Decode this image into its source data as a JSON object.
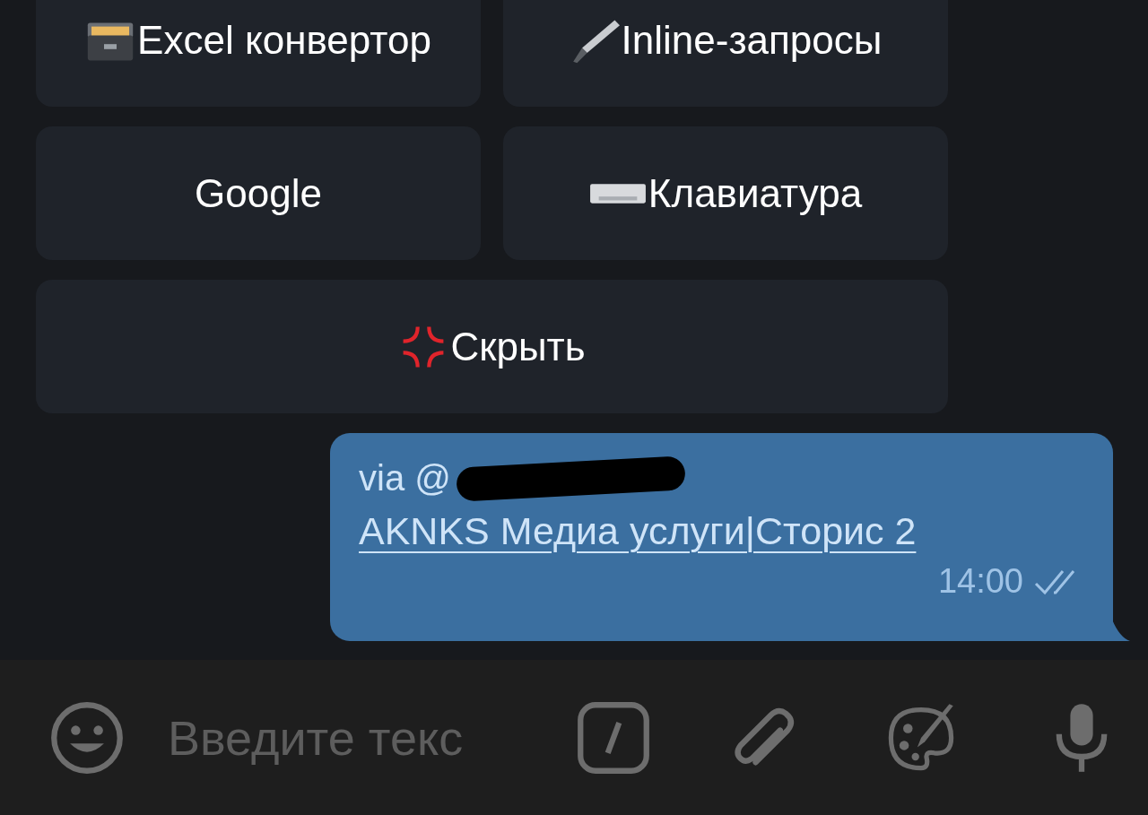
{
  "keyboard": {
    "buttons": [
      {
        "label": "Excel конвертор",
        "wide": false
      },
      {
        "label": "Inline-запросы",
        "wide": false
      },
      {
        "label": "Google",
        "wide": false
      },
      {
        "label": "Клавиатура",
        "wide": false
      },
      {
        "label": "Скрыть",
        "wide": true
      }
    ]
  },
  "message": {
    "via": "via @",
    "text": "AKNKS Медиа услуги|Сторис 2",
    "time": "14:00",
    "read": true
  },
  "composer": {
    "placeholder": "Введите текс"
  }
}
